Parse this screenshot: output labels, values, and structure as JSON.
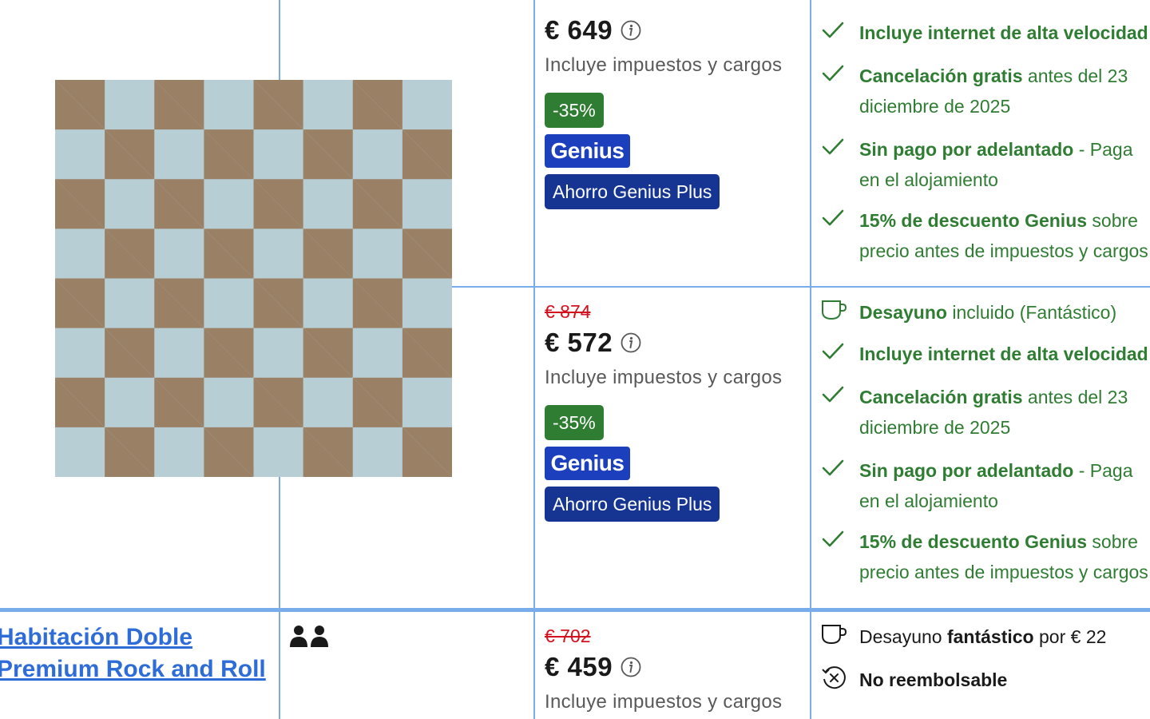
{
  "offers": [
    {
      "old_price": "",
      "price": "€ 649",
      "tax_note": "Incluye impuestos y cargos",
      "discount": "-35%",
      "genius": "Genius",
      "genius_plus": "Ahorro Genius Plus",
      "conditions": [
        {
          "icon": "check-icon",
          "strong": "Incluye internet de alta velocidad",
          "rest": ""
        },
        {
          "icon": "check-icon",
          "strong": "Cancelación gratis",
          "rest": " antes del 23",
          "line2": "diciembre de 2025"
        },
        {
          "icon": "check-icon",
          "strong": "Sin pago por adelantado",
          "rest": " - Paga",
          "line2": "en el alojamiento"
        },
        {
          "icon": "check-icon",
          "strong": "15% de descuento Genius",
          "rest": " sobre",
          "line2": "precio antes de impuestos y cargos"
        }
      ]
    },
    {
      "old_price": "€ 874",
      "price": "€ 572",
      "tax_note": "Incluye impuestos y cargos",
      "discount": "-35%",
      "genius": "Genius",
      "genius_plus": "Ahorro Genius Plus",
      "breakfast": {
        "strong": "Desayuno",
        "rest": " incluido (Fantástico)"
      },
      "conditions": [
        {
          "icon": "check-icon",
          "strong": "Incluye internet de alta velocidad",
          "rest": ""
        },
        {
          "icon": "check-icon",
          "strong": "Cancelación gratis",
          "rest": " antes del 23",
          "line2": "diciembre de 2025"
        },
        {
          "icon": "check-icon",
          "strong": "Sin pago por adelantado",
          "rest": " - Paga",
          "line2": "en el alojamiento"
        },
        {
          "icon": "check-icon",
          "strong": "15% de descuento Genius",
          "rest": " sobre",
          "line2": "precio antes de impuestos y cargos"
        }
      ]
    },
    {
      "room_name": "Habitación Doble Premium Rock and Roll",
      "old_price": "€ 702",
      "price": "€ 459",
      "tax_note": "Incluye impuestos y cargos",
      "breakfast": {
        "pre": "Desayuno ",
        "strong": "fantástico",
        "rest": " por € 22"
      },
      "non_refundable": "No reembolsable"
    }
  ],
  "colors": {
    "accent": "#2e6cd8",
    "green": "#2f7d32",
    "red": "#d4111e",
    "genius": "#1c3fbd",
    "border": "#79acea"
  }
}
